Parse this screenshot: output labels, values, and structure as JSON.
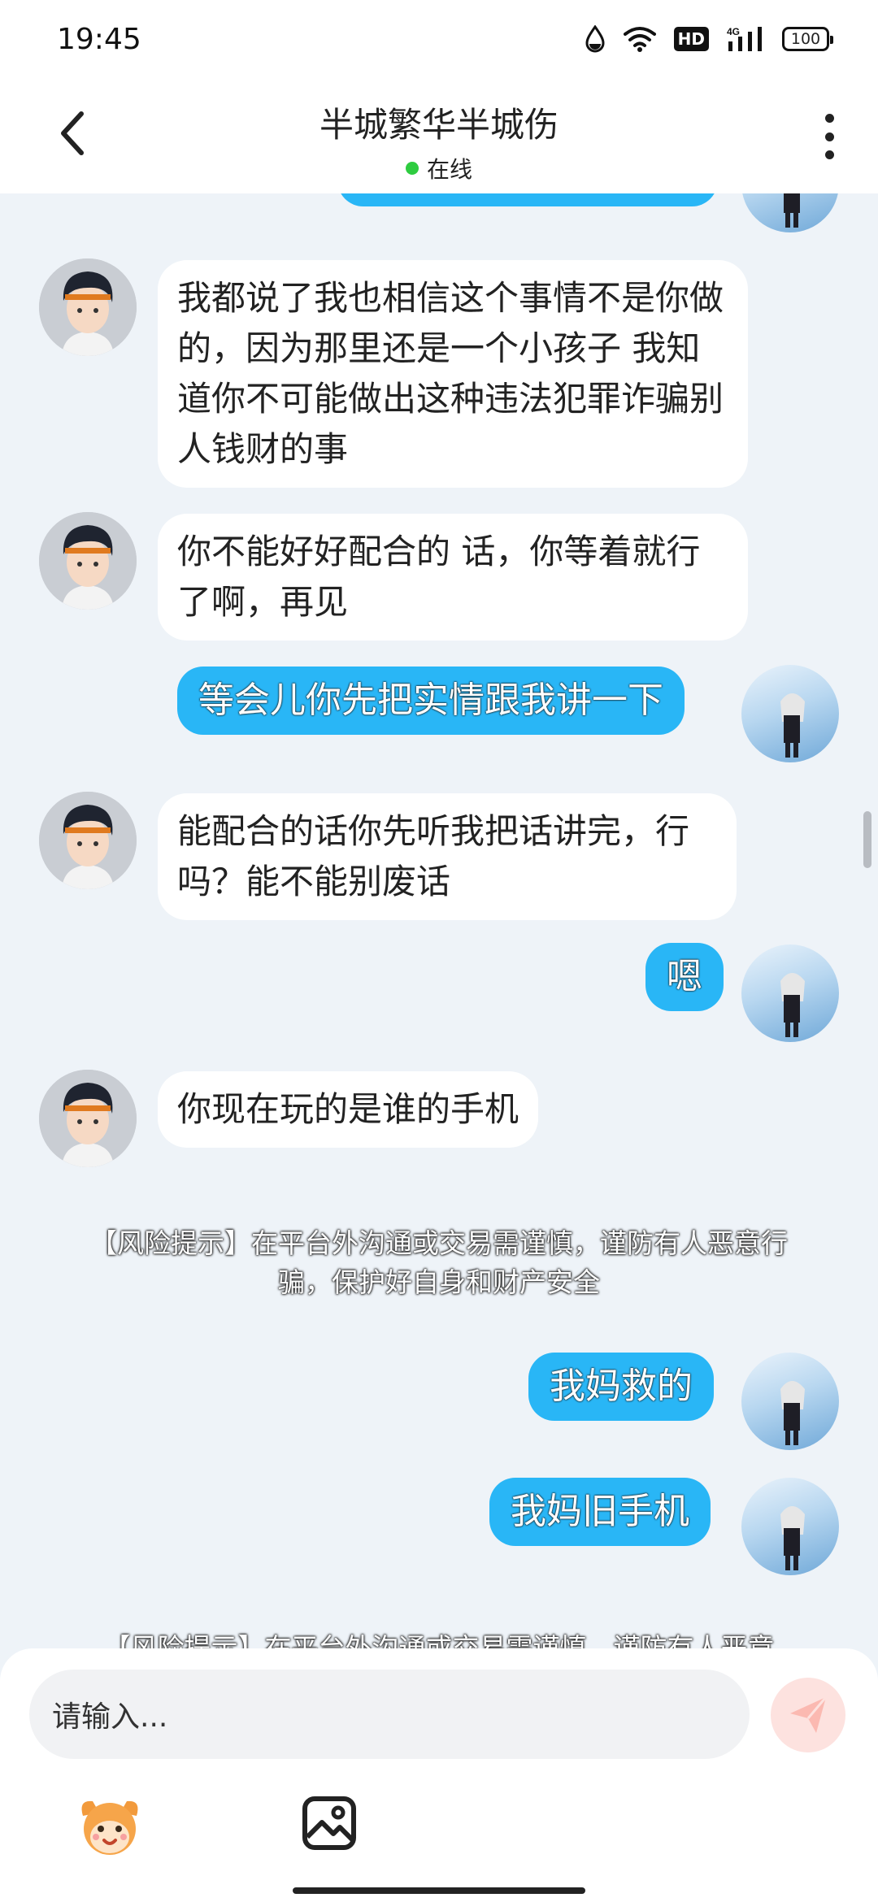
{
  "status_bar": {
    "time": "19:45",
    "hd": "HD",
    "network": "4G",
    "battery": "100"
  },
  "header": {
    "title": "半城繁华半城伤",
    "status": "在线",
    "back_icon": "chevron-left-icon",
    "more_icon": "more-vertical-icon"
  },
  "messages": [
    {
      "from": "other",
      "text": "我都说了我也相信这个事情不是你做的，因为那里还是一个小孩子 我知道你不可能做出这种违法犯罪诈骗别人钱财的事"
    },
    {
      "from": "other",
      "text": "你不能好好配合的 话，你等着就行了啊，再见"
    },
    {
      "from": "me",
      "text": "等会儿你先把实情跟我讲一下"
    },
    {
      "from": "other",
      "text": "能配合的话你先听我把话讲完，行吗？能不能别废话"
    },
    {
      "from": "me",
      "text": "嗯"
    },
    {
      "from": "other",
      "text": "你现在玩的是谁的手机"
    },
    {
      "from": "system",
      "text": "【风险提示】在平台外沟通或交易需谨慎，谨防有人恶意行骗，保护好自身和财产安全"
    },
    {
      "from": "me",
      "text": "我妈救的"
    },
    {
      "from": "me",
      "text": "我妈旧手机"
    },
    {
      "from": "system",
      "text": "【风险提示】在平台外沟通或交易需谨慎，谨防有人恶意"
    }
  ],
  "input": {
    "placeholder": "请输入..."
  },
  "toolbar": {
    "emoji_icon": "mascot-emoji-icon",
    "image_icon": "image-icon",
    "send_icon": "send-icon"
  },
  "colors": {
    "accent": "#29b6f6",
    "online": "#2ecc40",
    "background": "#eef3f8",
    "send_button": "#fde2df"
  }
}
